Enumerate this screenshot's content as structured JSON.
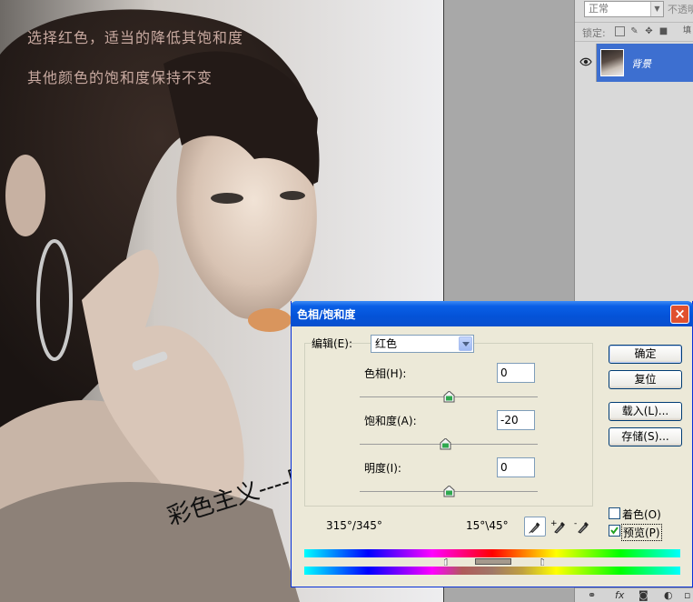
{
  "canvas": {
    "caption_line1": "选择红色，适当的降低其饱和度",
    "caption_line2": "其他颜色的饱和度保持不变",
    "watermark": "彩色主义----暗夜精灵"
  },
  "layers_panel": {
    "blend_mode": "正常",
    "opacity_label": "不透明",
    "lock_label": "锁定:",
    "layer_name": "背景"
  },
  "dialog": {
    "title": "色相/饱和度",
    "close_glyph": "×",
    "edit_label": "编辑(E):",
    "edit_value": "红色",
    "hue_label": "色相(H):",
    "hue_value": "0",
    "saturation_label": "饱和度(A):",
    "saturation_value": "-20",
    "lightness_label": "明度(I):",
    "lightness_value": "0",
    "range_left": "315°/345°",
    "range_right": "15°\\45°",
    "ok_label": "确定",
    "reset_label": "复位",
    "load_label": "载入(L)...",
    "save_label": "存储(S)...",
    "colorize_label": "着色(O)",
    "colorize_checked": false,
    "preview_label": "预览(P)",
    "preview_checked": true,
    "hue_level": 0,
    "saturation_level": -20,
    "lightness_level": 0
  },
  "icons": [
    "eye-icon",
    "eyedropper-icon",
    "eyedropper-plus-icon",
    "eyedropper-minus-icon",
    "close-icon",
    "chevron-down-icon",
    "lock-transparent-icon",
    "lock-paint-icon",
    "lock-move-icon",
    "lock-all-icon",
    "link-icon",
    "fx-icon",
    "mask-icon",
    "adjustment-icon"
  ],
  "colors": {
    "title_bar": "#0453d8",
    "layer_selected": "#3d6fd0",
    "caption_text": "#c8a9a0"
  }
}
